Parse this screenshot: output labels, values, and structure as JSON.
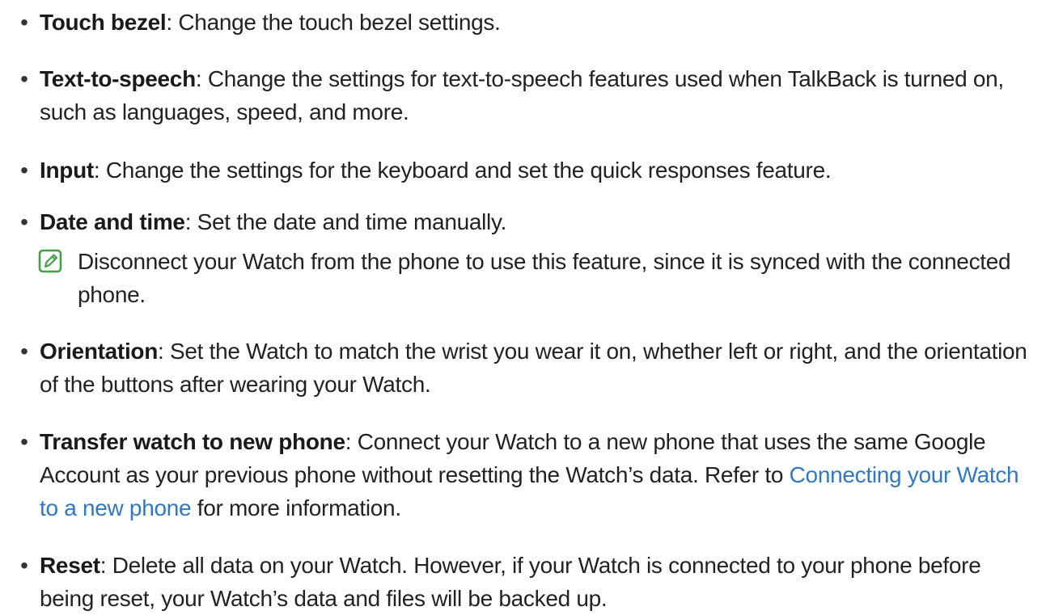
{
  "colors": {
    "text": "#222222",
    "link": "#2f78c4",
    "note_icon": "#43a047"
  },
  "items": [
    {
      "bullet": "•",
      "term": "Touch bezel",
      "desc": ": Change the touch bezel settings."
    },
    {
      "bullet": "•",
      "term": "Text-to-speech",
      "desc": ": Change the settings for text-to-speech features used when TalkBack is turned on, such as languages, speed, and more."
    },
    {
      "bullet": "•",
      "term": "Input",
      "desc": ": Change the settings for the keyboard and set the quick responses feature."
    },
    {
      "bullet": "•",
      "term": "Date and time",
      "desc": ": Set the date and time manually."
    },
    {
      "bullet": "•",
      "term": "Orientation",
      "desc": ": Set the Watch to match the wrist you wear it on, whether left or right, and the orientation of the buttons after wearing your Watch."
    },
    {
      "bullet": "•",
      "term": "Transfer watch to new phone",
      "desc": ": Connect your Watch to a new phone that uses the same Google Account as your previous phone without resetting the Watch’s data. Refer to ",
      "link": "Connecting your Watch to a new phone",
      "desc_after": " for more information."
    },
    {
      "bullet": "•",
      "term": "Reset",
      "desc": ": Delete all data on your Watch. However, if your Watch is connected to your phone before being reset, your Watch’s data and files will be backed up."
    }
  ],
  "note": {
    "icon": "note-pencil-icon",
    "text": "Disconnect your Watch from the phone to use this feature, since it is synced with the connected phone."
  }
}
